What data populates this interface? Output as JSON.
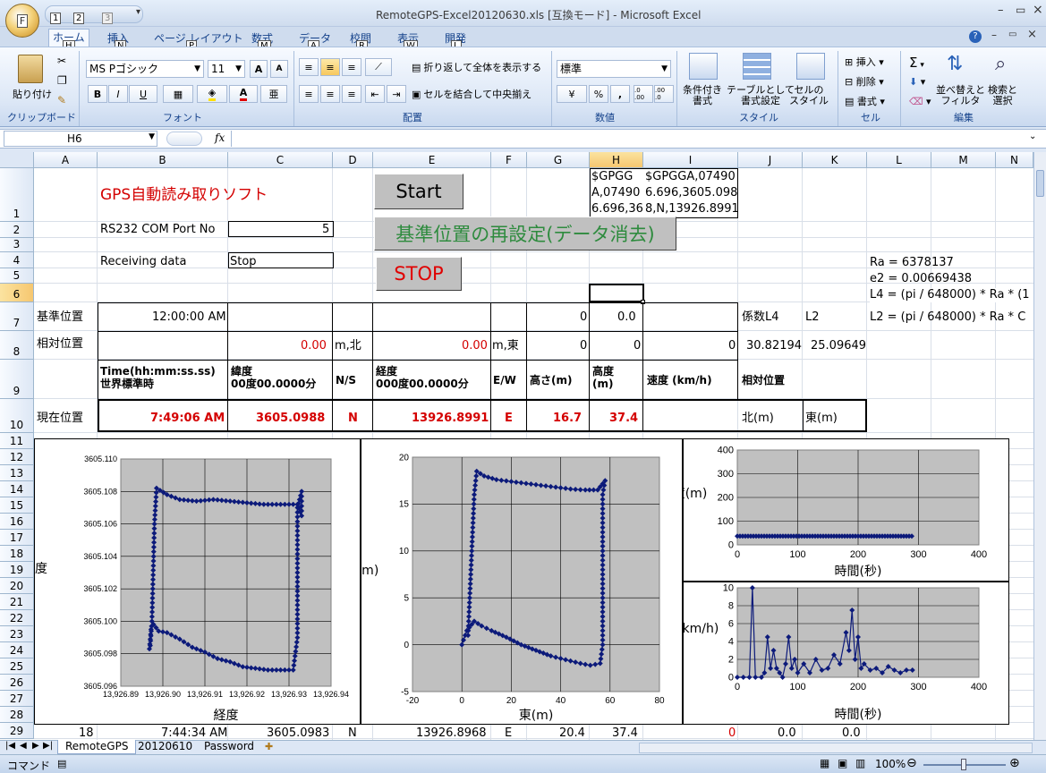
{
  "window": {
    "title": "RemoteGPS-Excel20120630.xls  [互換モード] - Microsoft Excel",
    "office_button": "F",
    "qat_keys": [
      "1",
      "2",
      "3"
    ]
  },
  "ribbon": {
    "tabs": [
      {
        "label": "ホーム",
        "key": "H"
      },
      {
        "label": "挿入",
        "key": "N"
      },
      {
        "label": "ページ レイアウト",
        "key": "P"
      },
      {
        "label": "数式",
        "key": "M"
      },
      {
        "label": "データ",
        "key": "A"
      },
      {
        "label": "校閲",
        "key": "R"
      },
      {
        "label": "表示",
        "key": "W"
      },
      {
        "label": "開発",
        "key": "L"
      }
    ],
    "clipboard": {
      "paste": "貼り付け",
      "label": "クリップボード"
    },
    "font": {
      "name": "MS Pゴシック",
      "size": "11",
      "label": "フォント",
      "bold": "B",
      "italic": "I",
      "underline": "U",
      "grow": "A",
      "shrink": "A"
    },
    "alignment": {
      "wrap": "折り返して全体を表示する",
      "merge": "セルを結合して中央揃え",
      "label": "配置"
    },
    "number": {
      "format": "標準",
      "percent": "%",
      "comma": ",",
      "inc": ".0 .00",
      "dec": ".00 .0",
      "label": "数値"
    },
    "styles": {
      "conditional": "条件付き\n書式",
      "table": "テーブルとして\n書式設定",
      "cell": "セルの\nスタイル",
      "label": "スタイル"
    },
    "cells": {
      "insert": "挿入",
      "delete": "削除",
      "format": "書式",
      "label": "セル"
    },
    "editing": {
      "sum": "Σ",
      "sort": "並べ替えと\nフィルタ",
      "find": "検索と\n選択",
      "label": "編集"
    }
  },
  "formula_bar": {
    "name_box": "H6",
    "fx": "fx",
    "content": ""
  },
  "columns": [
    "A",
    "B",
    "C",
    "D",
    "E",
    "F",
    "G",
    "H",
    "I",
    "J",
    "K",
    "L",
    "M",
    "N"
  ],
  "rows": [
    "1",
    "2",
    "3",
    "4",
    "5",
    "6",
    "7",
    "8",
    "9",
    "10",
    "11",
    "12",
    "13",
    "14",
    "15",
    "16",
    "17",
    "18",
    "19",
    "20",
    "21",
    "22",
    "23",
    "24",
    "25",
    "26",
    "27",
    "28",
    "29"
  ],
  "cells": {
    "title": "GPS自動読み取りソフト",
    "port_label": "RS232 COM Port No",
    "port_value": "5",
    "recv_label": "Receiving data",
    "recv_value": "Stop",
    "h1": "$GPGG\nA,07490\n6.696,36",
    "i1": "$GPGGA,07490\n6.696,3605.098\n8,N,13926.8991",
    "ra": "Ra = 6378137",
    "e2": "e2 = 0.00669438",
    "l4f": "L4 = (pi / 648000) * Ra * (1",
    "l2f": "L2 = (pi / 648000) * Ra * C",
    "base_label": "基準位置",
    "base_time": "12:00:00 AM",
    "g7": "0",
    "h7": "0.0",
    "j7": "係数L4",
    "k7": "L2",
    "rel_label": "相対位置",
    "c8": "0.00",
    "d8": "m,北",
    "e8": "0.00",
    "f8": "m,東",
    "g8": "0",
    "h8": "0",
    "i8": "0",
    "j8": "30.82194",
    "k8": "25.09649",
    "b9": "Time(hh:mm:ss.ss)\n世界標準時",
    "c9": "緯度\n00度00.0000分",
    "d9": "N/S",
    "e9": "経度\n000度00.0000分",
    "f9": "E/W",
    "g9": "高さ(m)",
    "h9": "高度\n(m)",
    "i9": "速度 (km/h)",
    "j9": "相対位置",
    "cur_label": "現在位置",
    "b10": "7:49:06 AM",
    "c10": "3605.0988",
    "d10": "N",
    "e10": "13926.8991",
    "f10": "E",
    "g10": "16.7",
    "h10": "37.4",
    "j10": "北(m)",
    "k10": "東(m)",
    "a29": "18",
    "b29": "7:44:34 AM",
    "c29": "3605.0983",
    "d29": "N",
    "e29": "13926.8968",
    "f29": "E",
    "g29": "20.4",
    "h29": "37.4",
    "i29": "0",
    "j29": "0.0",
    "k29": "0.0"
  },
  "buttons": {
    "start": "Start",
    "reset": "基準位置の再設定(データ消去)",
    "stop": "STOP"
  },
  "sheet_tabs": [
    "RemoteGPS",
    "20120610",
    "Password"
  ],
  "status": {
    "mode": "コマンド",
    "zoom": "100%"
  },
  "colors": {
    "red": "#d40000",
    "series": "#0c1a7a",
    "plot_bg": "#c0c0c0",
    "button_green": "#2e8b3e",
    "button_red": "#e00000"
  },
  "chart_data": [
    {
      "type": "scatter",
      "xlabel": "経度",
      "ylabel": "緯度",
      "xlim": [
        13926.89,
        13926.94
      ],
      "ylim": [
        3605.096,
        3605.11
      ],
      "x_ticks": [
        "13,926.89",
        "13,926.90",
        "13,926.91",
        "13,926.92",
        "13,926.93",
        "13,926.94"
      ],
      "y_ticks": [
        "3605.110",
        "3605.108",
        "3605.106",
        "3605.104",
        "3605.102",
        "3605.100",
        "3605.098",
        "3605.096"
      ],
      "points": [
        [
          13926.8968,
          3605.0983
        ],
        [
          13926.8972,
          3605.0995
        ],
        [
          13926.8978,
          3605.0998
        ],
        [
          13926.899,
          3605.0994
        ],
        [
          13926.901,
          3605.0993
        ],
        [
          13926.904,
          3605.0989
        ],
        [
          13926.907,
          3605.0984
        ],
        [
          13926.91,
          3605.0981
        ],
        [
          13926.913,
          3605.0977
        ],
        [
          13926.916,
          3605.0975
        ],
        [
          13926.919,
          3605.0972
        ],
        [
          13926.922,
          3605.0971
        ],
        [
          13926.925,
          3605.097
        ],
        [
          13926.928,
          3605.097
        ],
        [
          13926.931,
          3605.097
        ],
        [
          13926.932,
          3605.099
        ],
        [
          13926.932,
          3605.101
        ],
        [
          13926.932,
          3605.103
        ],
        [
          13926.932,
          3605.105
        ],
        [
          13926.932,
          3605.107
        ],
        [
          13926.933,
          3605.108
        ],
        [
          13926.933,
          3605.1065
        ],
        [
          13926.932,
          3605.1072
        ],
        [
          13926.928,
          3605.1072
        ],
        [
          13926.924,
          3605.1072
        ],
        [
          13926.92,
          3605.1073
        ],
        [
          13926.916,
          3605.1074
        ],
        [
          13926.912,
          3605.1075
        ],
        [
          13926.908,
          3605.1074
        ],
        [
          13926.904,
          3605.1075
        ],
        [
          13926.901,
          3605.1078
        ],
        [
          13926.8985,
          3605.1082
        ],
        [
          13926.898,
          3605.106
        ],
        [
          13926.8978,
          3605.104
        ],
        [
          13926.8976,
          3605.102
        ],
        [
          13926.8974,
          3605.1
        ],
        [
          13926.897,
          3605.0985
        ]
      ]
    },
    {
      "type": "scatter",
      "xlabel": "東(m)",
      "ylabel": "北(m)",
      "xlim": [
        -20,
        80
      ],
      "ylim": [
        -5,
        20
      ],
      "x_ticks": [
        "-20",
        "0",
        "20",
        "40",
        "60",
        "80"
      ],
      "y_ticks": [
        "20",
        "15",
        "10",
        "5",
        "0",
        "-5"
      ],
      "points": [
        [
          0,
          0
        ],
        [
          2,
          1.5
        ],
        [
          5,
          2.5
        ],
        [
          8,
          2
        ],
        [
          12,
          1.5
        ],
        [
          18,
          0.8
        ],
        [
          24,
          0
        ],
        [
          30,
          -0.6
        ],
        [
          36,
          -1.2
        ],
        [
          42,
          -1.6
        ],
        [
          48,
          -2
        ],
        [
          52,
          -2.2
        ],
        [
          56,
          -2
        ],
        [
          57,
          0
        ],
        [
          57,
          4
        ],
        [
          57,
          8
        ],
        [
          57,
          12
        ],
        [
          57,
          16
        ],
        [
          58,
          17.5
        ],
        [
          55,
          16.5
        ],
        [
          50,
          16.5
        ],
        [
          44,
          16.6
        ],
        [
          38,
          16.8
        ],
        [
          32,
          17
        ],
        [
          26,
          17.2
        ],
        [
          20,
          17.4
        ],
        [
          14,
          17.6
        ],
        [
          9,
          18
        ],
        [
          6,
          18.5
        ],
        [
          5,
          16
        ],
        [
          4.5,
          13
        ],
        [
          4,
          10
        ],
        [
          3.5,
          7
        ],
        [
          3,
          4
        ],
        [
          2.5,
          1
        ]
      ]
    },
    {
      "type": "scatter",
      "xlabel": "時間(秒)",
      "ylabel": "高度(m)",
      "xlim": [
        0,
        400
      ],
      "ylim": [
        0,
        400
      ],
      "x_ticks": [
        "0",
        "100",
        "200",
        "300",
        "400"
      ],
      "y_ticks": [
        "400",
        "300",
        "200",
        "100",
        "0"
      ],
      "series": [
        {
          "x_start": 0,
          "x_end": 290,
          "y": 37
        }
      ]
    },
    {
      "type": "line",
      "xlabel": "時間(秒)",
      "ylabel": "速度 (km/h)",
      "xlim": [
        0,
        400
      ],
      "ylim": [
        0,
        10
      ],
      "x_ticks": [
        "0",
        "100",
        "200",
        "300",
        "400"
      ],
      "y_ticks": [
        "10",
        "8",
        "6",
        "4",
        "2",
        "0"
      ],
      "points": [
        [
          0,
          0
        ],
        [
          10,
          0
        ],
        [
          20,
          0
        ],
        [
          25,
          10
        ],
        [
          30,
          0
        ],
        [
          40,
          0
        ],
        [
          45,
          0.5
        ],
        [
          50,
          4.5
        ],
        [
          55,
          1
        ],
        [
          60,
          3
        ],
        [
          65,
          1
        ],
        [
          70,
          0.5
        ],
        [
          75,
          0
        ],
        [
          80,
          1.5
        ],
        [
          85,
          4.5
        ],
        [
          90,
          1
        ],
        [
          95,
          2
        ],
        [
          100,
          0.5
        ],
        [
          110,
          1.5
        ],
        [
          120,
          0.5
        ],
        [
          130,
          2
        ],
        [
          140,
          0.8
        ],
        [
          150,
          1
        ],
        [
          160,
          2.5
        ],
        [
          170,
          1.5
        ],
        [
          180,
          5
        ],
        [
          185,
          3
        ],
        [
          190,
          7.5
        ],
        [
          195,
          2
        ],
        [
          200,
          4.5
        ],
        [
          205,
          1
        ],
        [
          210,
          1.5
        ],
        [
          220,
          0.8
        ],
        [
          230,
          1
        ],
        [
          240,
          0.5
        ],
        [
          250,
          1.2
        ],
        [
          260,
          0.8
        ],
        [
          270,
          0.5
        ],
        [
          280,
          0.8
        ],
        [
          290,
          0.8
        ]
      ]
    }
  ]
}
